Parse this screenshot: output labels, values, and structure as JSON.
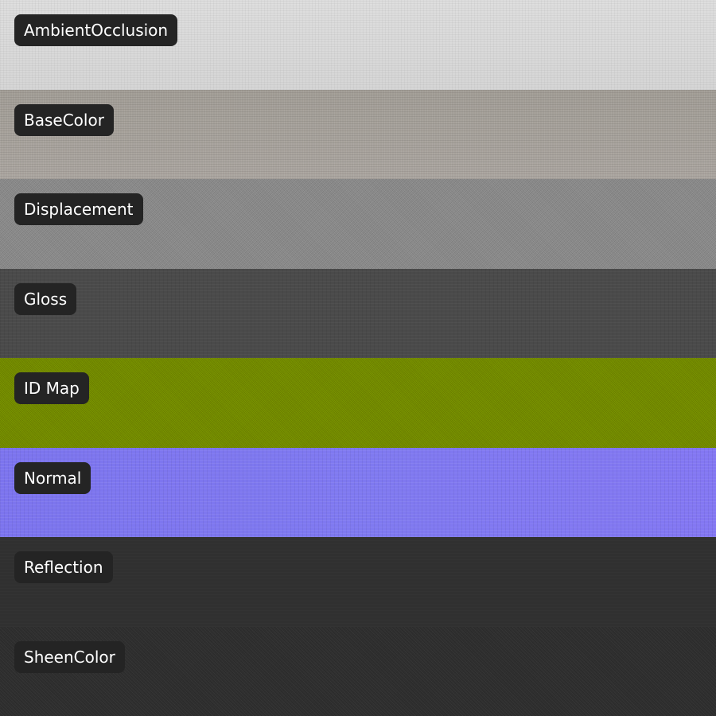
{
  "maps": [
    {
      "label": "AmbientOcclusion",
      "color": "#dadada"
    },
    {
      "label": "BaseColor",
      "color": "#a6a19b"
    },
    {
      "label": "Displacement",
      "color": "#8c8c8c"
    },
    {
      "label": "Gloss",
      "color": "#4a4a4a"
    },
    {
      "label": "ID Map",
      "color": "#7a9600"
    },
    {
      "label": "Normal",
      "color": "#7f78f0"
    },
    {
      "label": "Reflection",
      "color": "#303030"
    },
    {
      "label": "SheenColor",
      "color": "#2f2f2f"
    }
  ]
}
